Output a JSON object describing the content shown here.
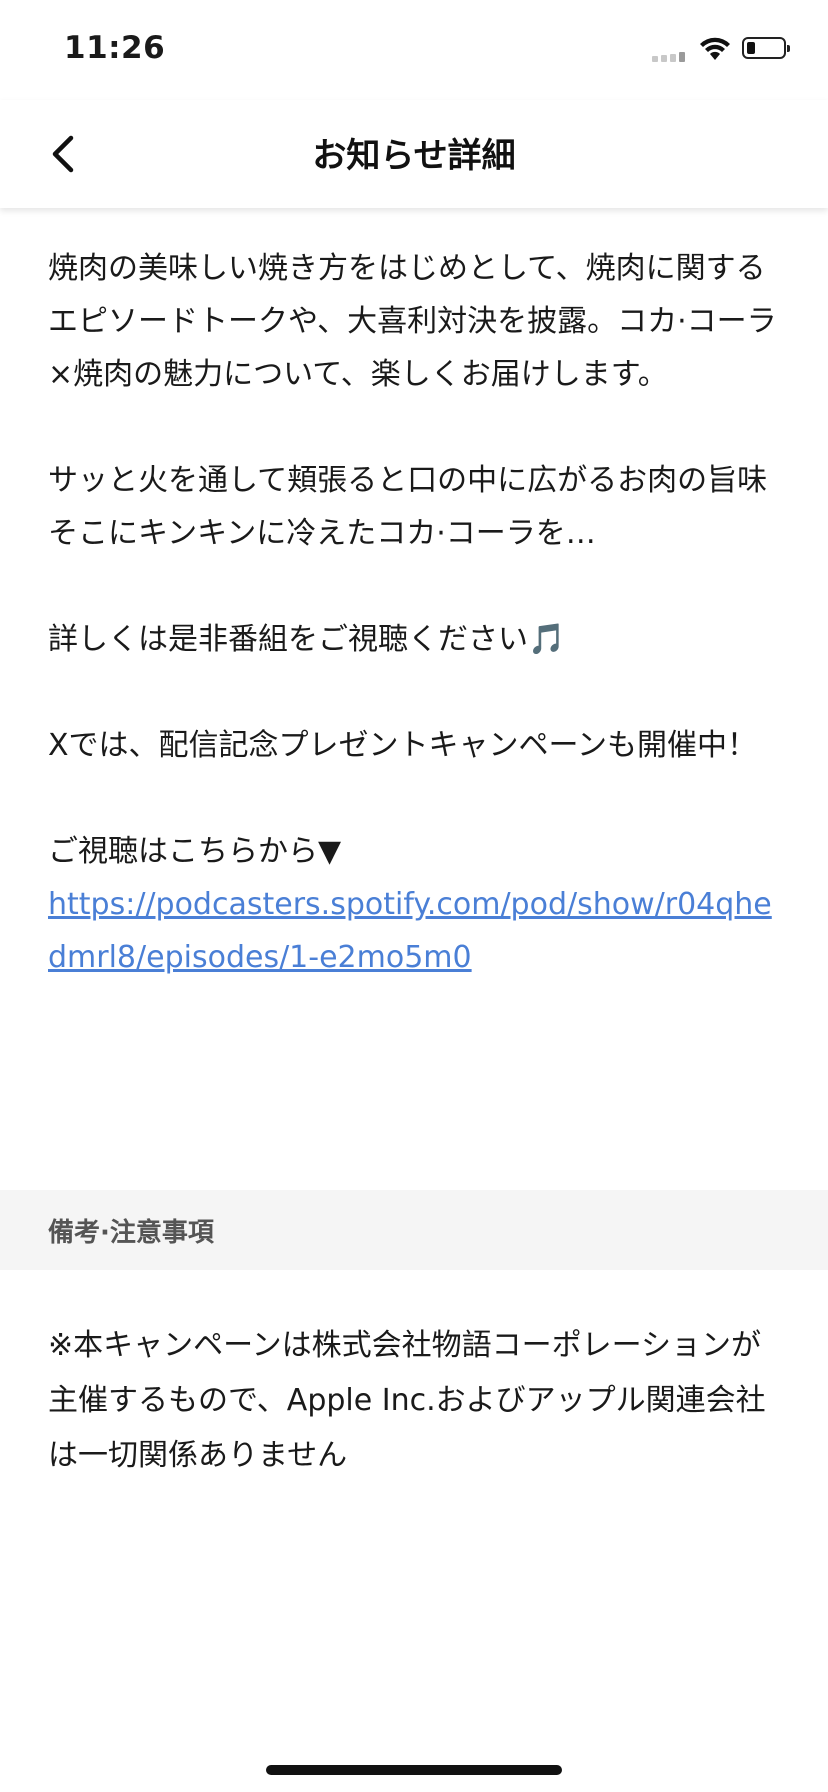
{
  "status_bar": {
    "time": "11:26",
    "battery_level": 0.2
  },
  "nav": {
    "title": "お知らせ詳細",
    "back_icon": "chevron-left-icon"
  },
  "content": {
    "paragraph_1": "焼肉の美味しい焼き方をはじめとして、焼肉に関するエピソードトークや、大喜利対決を披露。コカ·コーラ×焼肉の魅力について、楽しくお届けします。",
    "paragraph_2": "サッと火を通して頬張ると口の中に広がるお肉の旨味\nそこにキンキンに冷えたコカ·コーラを…",
    "paragraph_3": "詳しくは是非番組をご視聴ください🎵",
    "paragraph_4": "Xでは、配信記念プレゼントキャンペーンも開催中！",
    "watch_label": "ご視聴はこちらから▼",
    "link_url": "https://podcasters.spotify.com/pod/show/r04qhedmrl8/episodes/1-e2mo5m0"
  },
  "notes": {
    "header": "備考·注意事項",
    "body": "※本キャンペーンは株式会社物語コーポレーションが主催するもので、Apple Inc.およびアップル関連会社は一切関係ありません"
  }
}
